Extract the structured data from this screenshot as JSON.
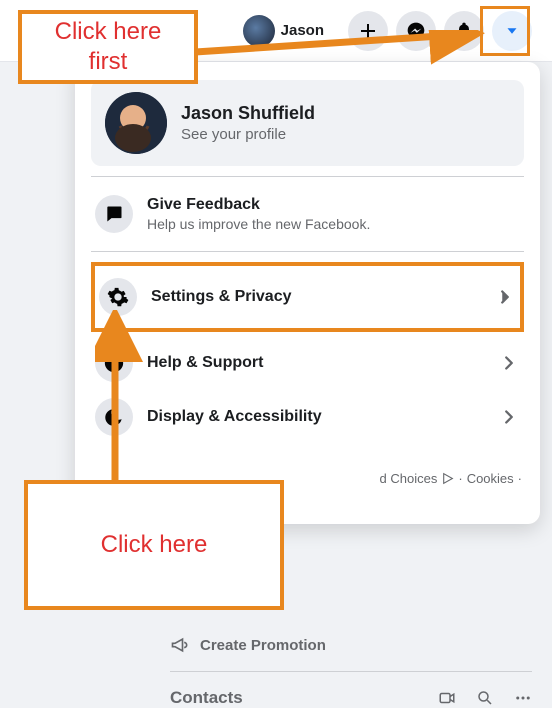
{
  "topbar": {
    "profile_name": "Jason",
    "icons": {
      "plus": "plus-icon",
      "messenger": "messenger-icon",
      "bell": "bell-icon",
      "dropdown": "dropdown-caret-icon"
    }
  },
  "annotations": {
    "callout1": "Click here first",
    "callout2": "Click here",
    "highlight_color": "#e8871e"
  },
  "panel": {
    "profile": {
      "name": "Jason Shuffield",
      "sub": "See your profile"
    },
    "feedback": {
      "title": "Give Feedback",
      "sub": "Help us improve the new Facebook."
    },
    "items": [
      {
        "title": "Settings & Privacy",
        "icon": "gear-icon"
      },
      {
        "title": "Help & Support",
        "icon": "question-icon"
      },
      {
        "title": "Display & Accessibility",
        "icon": "moon-icon"
      }
    ],
    "footer": {
      "adchoices": "d Choices",
      "cookies": "Cookies"
    }
  },
  "under": {
    "promo": "Create Promotion",
    "contacts": "Contacts"
  }
}
